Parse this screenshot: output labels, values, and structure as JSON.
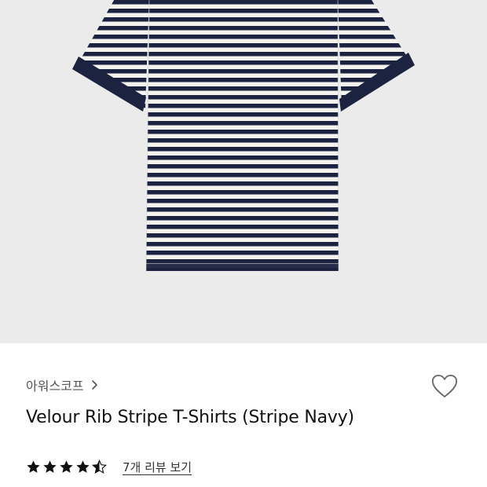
{
  "product": {
    "image_icon": "striped-tshirt",
    "colors": {
      "background": "#ebebeb",
      "navy": "#1c2340",
      "cream": "#f5f3ee"
    }
  },
  "brand": {
    "name": "아워스코프",
    "chevron_icon": "chevron-right-icon"
  },
  "wishlist": {
    "icon": "heart-outline-icon"
  },
  "title": "Velour Rib Stripe T-Shirts (Stripe Navy)",
  "rating": {
    "value": 4.5,
    "max": 5,
    "star_icon": "star-icon"
  },
  "reviews": {
    "link_text": "7개 리뷰 보기"
  }
}
